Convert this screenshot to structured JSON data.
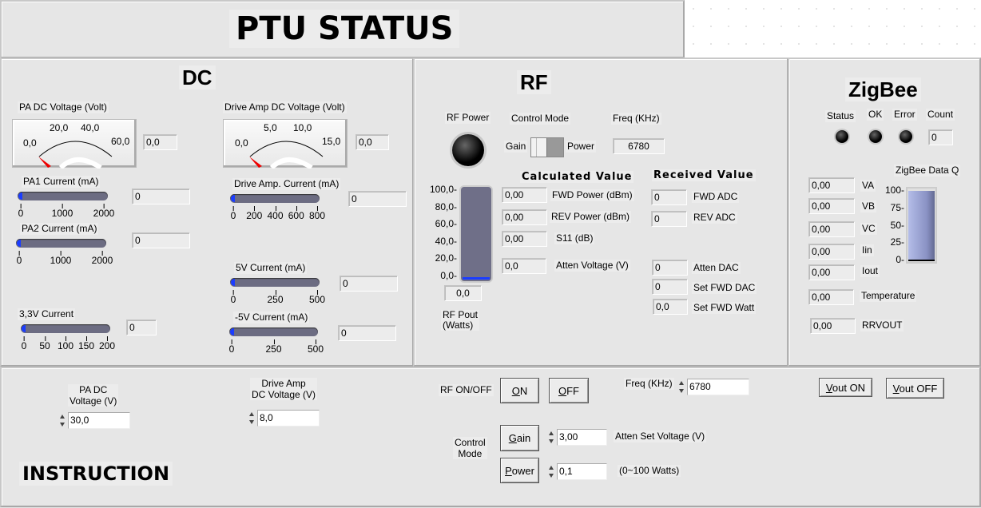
{
  "title": "PTU STATUS",
  "dc": {
    "title": "DC",
    "pa_voltage": {
      "label": "PA DC Voltage (Volt)",
      "ticks": [
        "0,0",
        "20,0",
        "40,0",
        "60,0"
      ],
      "value": "0,0"
    },
    "drive_voltage": {
      "label": "Drive Amp DC Voltage (Volt)",
      "ticks": [
        "0,0",
        "5,0",
        "10,0",
        "15,0"
      ],
      "value": "0,0"
    },
    "pa1": {
      "label": "PA1 Current (mA)",
      "ticks": [
        "0",
        "1000",
        "2000"
      ],
      "value": "0"
    },
    "pa2": {
      "label": "PA2 Current (mA)",
      "ticks": [
        "0",
        "1000",
        "2000"
      ],
      "value": "0"
    },
    "v33": {
      "label": "3,3V Current",
      "ticks": [
        "0",
        "50",
        "100",
        "150",
        "200"
      ],
      "value": "0"
    },
    "drive_current": {
      "label": "Drive Amp. Current (mA)",
      "ticks": [
        "0",
        "200",
        "400",
        "600",
        "800"
      ],
      "value": "0"
    },
    "v5": {
      "label": "5V Current (mA)",
      "ticks": [
        "0",
        "250",
        "500"
      ],
      "value": "0"
    },
    "vm5": {
      "label": "-5V Current (mA)",
      "ticks": [
        "0",
        "250",
        "500"
      ],
      "value": "0"
    }
  },
  "rf": {
    "title": "RF",
    "rf_power_label": "RF Power",
    "control_mode_label": "Control Mode",
    "gain_label": "Gain",
    "power_label": "Power",
    "freq_label": "Freq (KHz)",
    "freq_value": "6780",
    "pout_ticks": [
      "100,0",
      "80,0",
      "60,0",
      "40,0",
      "20,0",
      "0,0"
    ],
    "pout_value": "0,0",
    "pout_level": 0,
    "pout_label": "RF Pout\n(Watts)",
    "calc_title": "Calculated Value",
    "recv_title": "Received Value",
    "calc": [
      {
        "value": "0,00",
        "label": "FWD Power (dBm)"
      },
      {
        "value": "0,00",
        "label": "REV Power (dBm)"
      },
      {
        "value": "0,00",
        "label": "S11 (dB)"
      },
      {
        "value": "0,0",
        "label": "Atten Voltage (V)"
      }
    ],
    "recv": [
      {
        "value": "0",
        "label": "FWD ADC"
      },
      {
        "value": "0",
        "label": "REV ADC"
      },
      {
        "value": "0",
        "label": "Atten DAC"
      },
      {
        "value": "0",
        "label": "Set FWD DAC"
      },
      {
        "value": "0,0",
        "label": "Set FWD Watt"
      }
    ]
  },
  "zigbee": {
    "title": "ZigBee",
    "status_label": "Status",
    "ok_label": "OK",
    "error_label": "Error",
    "count_label": "Count",
    "count_value": "0",
    "dataq_label": "ZigBee Data Q",
    "dataq_ticks": [
      "100",
      "75",
      "50",
      "25",
      "0"
    ],
    "dataq_level": 100,
    "rows": [
      {
        "value": "0,00",
        "label": "VA"
      },
      {
        "value": "0,00",
        "label": "VB"
      },
      {
        "value": "0,00",
        "label": "VC"
      },
      {
        "value": "0,00",
        "label": "Iin"
      },
      {
        "value": "0,00",
        "label": "Iout"
      },
      {
        "value": "0,00",
        "label": "Temperature"
      },
      {
        "value": "0,00",
        "label": "RRVOUT"
      }
    ]
  },
  "instruction": {
    "title": "INSTRUCTION",
    "pa_label": "PA DC\nVoltage (V)",
    "pa_value": "30,0",
    "drive_label": "Drive Amp\nDC Voltage (V)",
    "drive_value": "8,0",
    "rf_onoff_label": "RF ON/OFF",
    "on": "ON",
    "off": "OFF",
    "freq_label": "Freq (KHz)",
    "freq_value": "6780",
    "vout_on": "Vout ON",
    "vout_off": "Vout OFF",
    "control_mode_label": "Control\nMode",
    "gain": "Gain",
    "power": "Power",
    "atten_value": "3,00",
    "atten_label": "Atten Set Voltage (V)",
    "watt_value": "0,1",
    "watt_label": "(0~100 Watts)"
  }
}
